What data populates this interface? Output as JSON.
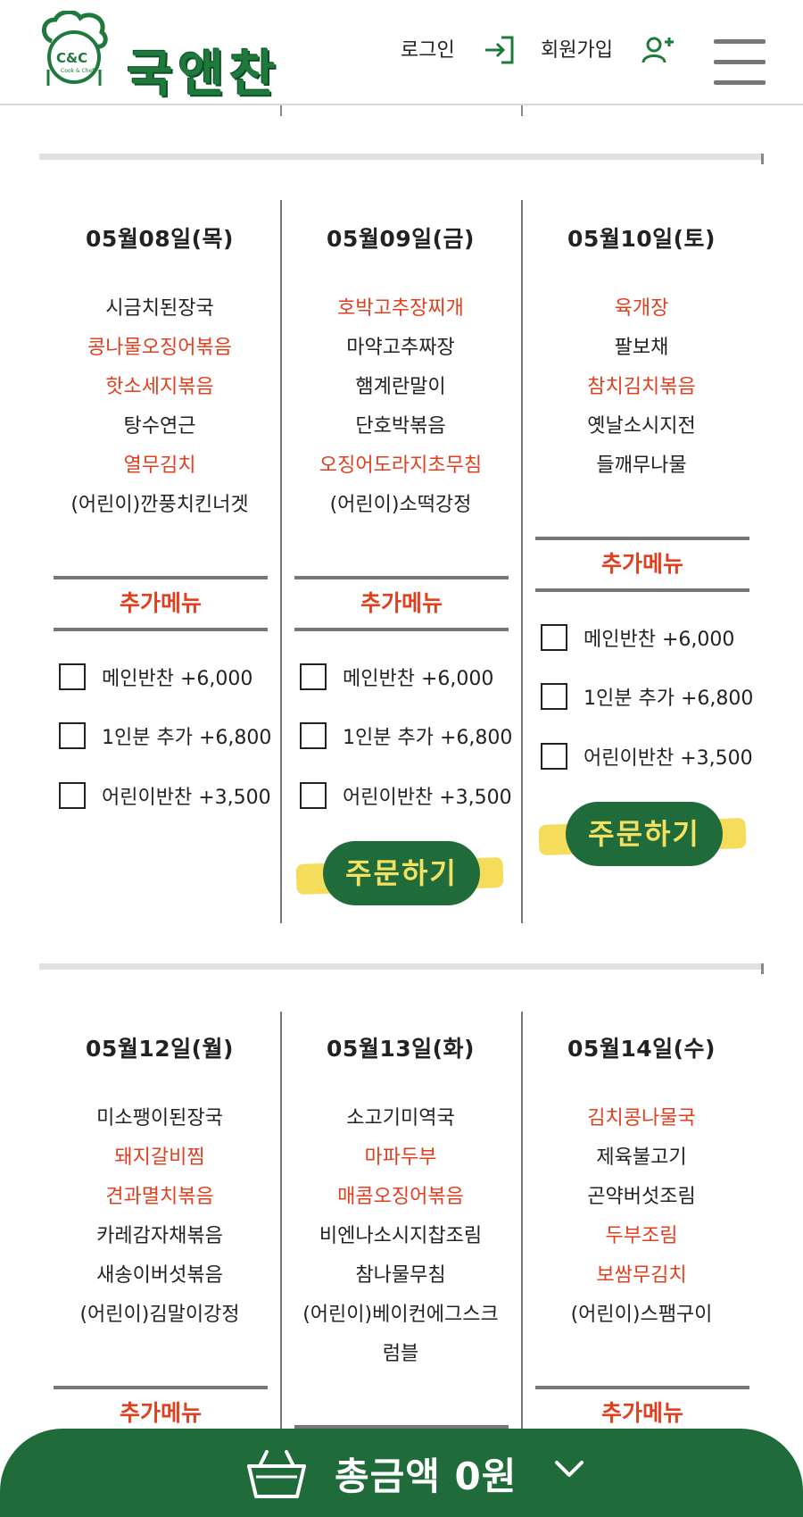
{
  "header": {
    "logo_badge": "C&C",
    "logo_sub": "Cook & Chef",
    "logo_name": "국앤찬",
    "login_label": "로그인",
    "signup_label": "회원가입"
  },
  "extra_menu_title": "추가메뉴",
  "order_label": "주문하기",
  "options": [
    {
      "label": "메인반찬 +6,000"
    },
    {
      "label": "1인분 추가 +6,800"
    },
    {
      "label": "어린이반찬 +3,500"
    }
  ],
  "days": [
    {
      "date": "05월08일(목)",
      "dishes": [
        {
          "name": "시금치된장국",
          "red": false
        },
        {
          "name": "콩나물오징어볶음",
          "red": true
        },
        {
          "name": "핫소세지볶음",
          "red": true
        },
        {
          "name": "탕수연근",
          "red": false
        },
        {
          "name": "열무김치",
          "red": true
        },
        {
          "name": "(어린이)깐풍치킨너겟",
          "red": false
        }
      ]
    },
    {
      "date": "05월09일(금)",
      "dishes": [
        {
          "name": "호박고추장찌개",
          "red": true
        },
        {
          "name": "마약고추짜장",
          "red": false
        },
        {
          "name": "햄계란말이",
          "red": false
        },
        {
          "name": "단호박볶음",
          "red": false
        },
        {
          "name": "오징어도라지초무침",
          "red": true
        },
        {
          "name": "(어린이)소떡강정",
          "red": false
        }
      ]
    },
    {
      "date": "05월10일(토)",
      "dishes": [
        {
          "name": "육개장",
          "red": true
        },
        {
          "name": "팔보채",
          "red": false
        },
        {
          "name": "참치김치볶음",
          "red": true
        },
        {
          "name": "옛날소시지전",
          "red": false
        },
        {
          "name": "들깨무나물",
          "red": false
        }
      ]
    },
    {
      "date": "05월12일(월)",
      "dishes": [
        {
          "name": "미소팽이된장국",
          "red": false
        },
        {
          "name": "돼지갈비찜",
          "red": true
        },
        {
          "name": "견과멸치볶음",
          "red": true
        },
        {
          "name": "카레감자채볶음",
          "red": false
        },
        {
          "name": "새송이버섯볶음",
          "red": false
        },
        {
          "name": "(어린이)김말이강정",
          "red": false
        }
      ]
    },
    {
      "date": "05월13일(화)",
      "dishes": [
        {
          "name": "소고기미역국",
          "red": false
        },
        {
          "name": "마파두부",
          "red": true
        },
        {
          "name": "매콤오징어볶음",
          "red": true
        },
        {
          "name": "비엔나소시지찹조림",
          "red": false
        },
        {
          "name": "참나물무침",
          "red": false
        },
        {
          "name": "(어린이)베이컨에그스크",
          "red": false
        },
        {
          "name": "럼블",
          "red": false
        }
      ]
    },
    {
      "date": "05월14일(수)",
      "dishes": [
        {
          "name": "김치콩나물국",
          "red": true
        },
        {
          "name": "제육불고기",
          "red": false
        },
        {
          "name": "곤약버섯조림",
          "red": false
        },
        {
          "name": "두부조림",
          "red": true
        },
        {
          "name": "보쌈무김치",
          "red": true
        },
        {
          "name": "(어린이)스팸구이",
          "red": false
        }
      ]
    }
  ],
  "bottom": {
    "total_label": "총금액 0원"
  },
  "colors": {
    "brand": "#1f6b3a",
    "accent_red": "#e0401f",
    "highlight": "#f3e163"
  }
}
